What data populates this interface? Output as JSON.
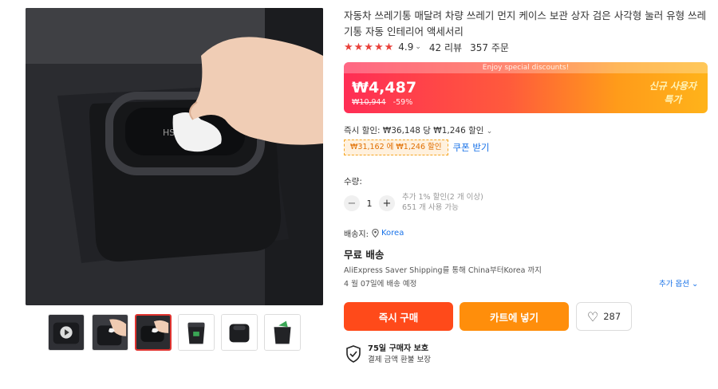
{
  "product": {
    "title": "자동차 쓰레기통 매달려 차량 쓰레기 먼지 케이스 보관 상자 검은 사각형 눌러 유형 쓰레기통 자동 인테리어 액세서리",
    "rating": "4.9",
    "reviews": "42 리뷰",
    "orders": "357 주문",
    "image_label": "HS"
  },
  "price": {
    "banner_note": "Enjoy special discounts!",
    "current": "₩4,487",
    "original": "₩10,944",
    "discount": "-59%",
    "badge_line1": "신규 사용자",
    "badge_line2": "특가"
  },
  "promo": {
    "instant_discount": "즉시 할인: ₩36,148 당 ₩1,246 할인",
    "coupon_tag": "₩31,162 에 ₩1,246 할인",
    "coupon_link": "쿠폰 받기"
  },
  "quantity": {
    "label": "수량:",
    "minus": "−",
    "value": "1",
    "plus": "+",
    "bulk_discount": "추가 1% 할인(2 개 이상)",
    "stock": "651 개 사용 가능"
  },
  "shipping": {
    "ship_to_label": "배송지:",
    "country": "Korea",
    "free_label": "무료 배송",
    "description": "AliExpress Saver Shipping를 통해 China부터Korea 까지",
    "delivery_date": "4 월 07일에 배송 예정",
    "more_options": "추가 옵션"
  },
  "actions": {
    "buy_now": "즉시 구매",
    "add_to_cart": "카트에 넣기",
    "wishlist_count": "287"
  },
  "protection": {
    "title": "75일 구매자 보호",
    "subtitle": "결제 금액 환불 보장"
  },
  "icons": [
    "star-icon",
    "chevron-down-icon",
    "minus-icon",
    "plus-icon",
    "location-pin-icon",
    "heart-icon",
    "shield-check-icon",
    "play-icon"
  ],
  "colors": {
    "accent_red": "#ff4a1a",
    "cart_orange": "#ff8e0b",
    "link_blue": "#1a73e8",
    "star_red": "#e8403a"
  },
  "gallery": {
    "thumbnail_count": 6,
    "selected_index": 2
  }
}
